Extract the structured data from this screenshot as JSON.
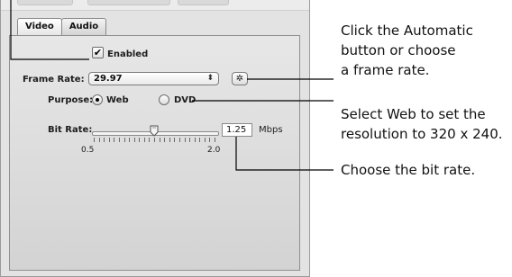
{
  "tabs": {
    "video": "Video",
    "audio": "Audio"
  },
  "enabled": {
    "label": "Enabled",
    "checked": true,
    "check_glyph": "✔"
  },
  "frame_rate": {
    "label": "Frame Rate:",
    "value": "29.97",
    "arrows_glyph": "⬍",
    "gear_glyph": "✲"
  },
  "purpose": {
    "label": "Purpose:",
    "options": [
      "Web",
      "DVD"
    ],
    "selected": "Web"
  },
  "bit_rate": {
    "label": "Bit Rate:",
    "min_label": "0.5",
    "max_label": "2.0",
    "value": "1.25",
    "unit": "Mbps"
  },
  "callouts": {
    "c1": [
      "Click the Automatic",
      "button or choose",
      "a frame rate."
    ],
    "c2": [
      "Select Web to set the",
      "resolution to 320 x 240."
    ],
    "c3": [
      "Choose the bit rate."
    ]
  }
}
